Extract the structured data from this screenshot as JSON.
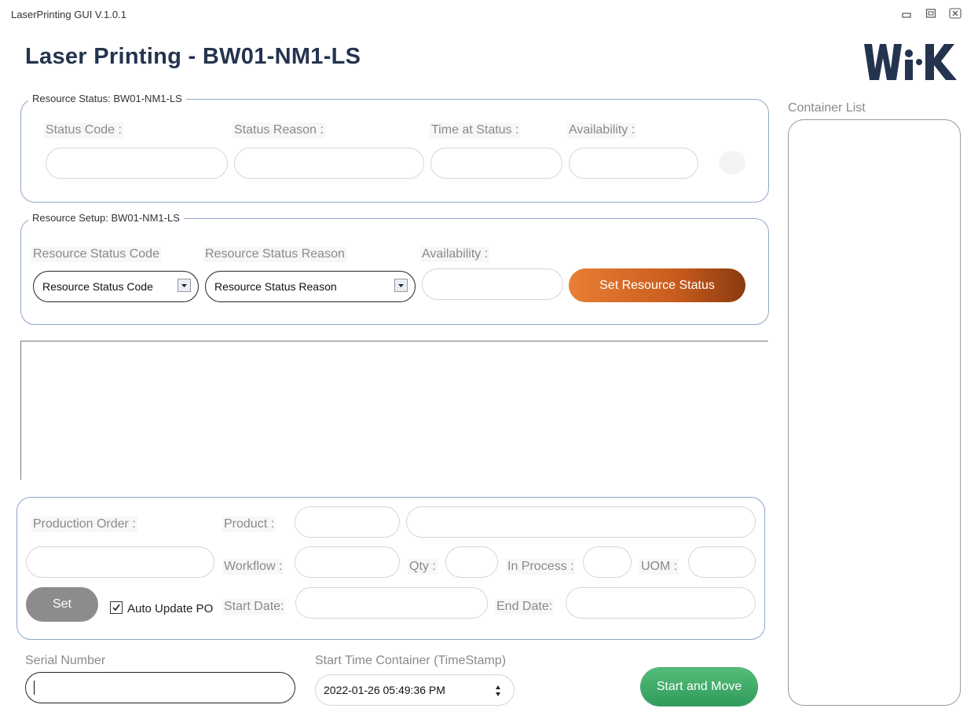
{
  "window": {
    "title": "LaserPrinting GUI V.1.0.1",
    "controls": [
      "minimize-icon",
      "restore-icon",
      "close-icon"
    ]
  },
  "header": {
    "title": "Laser Printing - BW01-NM1-LS",
    "logo_text": "WIK"
  },
  "colors": {
    "title": "#24344f",
    "accent_orange": "#d96a26",
    "accent_green": "#3aa866",
    "group_border": "#8fa6c8"
  },
  "resource_status": {
    "legend": "Resource Status: BW01-NM1-LS",
    "status_code_label": "Status Code :",
    "status_reason_label": "Status Reason :",
    "time_at_status_label": "Time at Status :",
    "availability_label": "Availability :",
    "status_code_value": "",
    "status_reason_value": "",
    "time_at_status_value": "",
    "availability_value": ""
  },
  "resource_setup": {
    "legend": "Resource Setup: BW01-NM1-LS",
    "status_code_label": "Resource Status Code",
    "status_reason_label": "Resource Status Reason",
    "availability_label": "Availability :",
    "status_code_selected": "Resource Status Code",
    "status_reason_selected": "Resource Status Reason",
    "availability_value": "",
    "set_button": "Set Resource Status"
  },
  "production": {
    "production_order_label": "Production Order :",
    "product_label": "Product :",
    "workflow_label": "Workflow :",
    "qty_label": "Qty :",
    "in_process_label": "In Process :",
    "uom_label": "UOM :",
    "start_date_label": "Start Date:",
    "end_date_label": "End Date:",
    "set_button": "Set",
    "auto_update_label": "Auto Update PO",
    "auto_update_checked": true
  },
  "footer": {
    "serial_label": "Serial Number",
    "serial_value": "",
    "timestamp_label": "Start Time Container (TimeStamp)",
    "timestamp_value": "2022-01-26 05:49:36 PM",
    "start_move_button": "Start and Move"
  },
  "container_list": {
    "label": "Container List",
    "items": []
  }
}
